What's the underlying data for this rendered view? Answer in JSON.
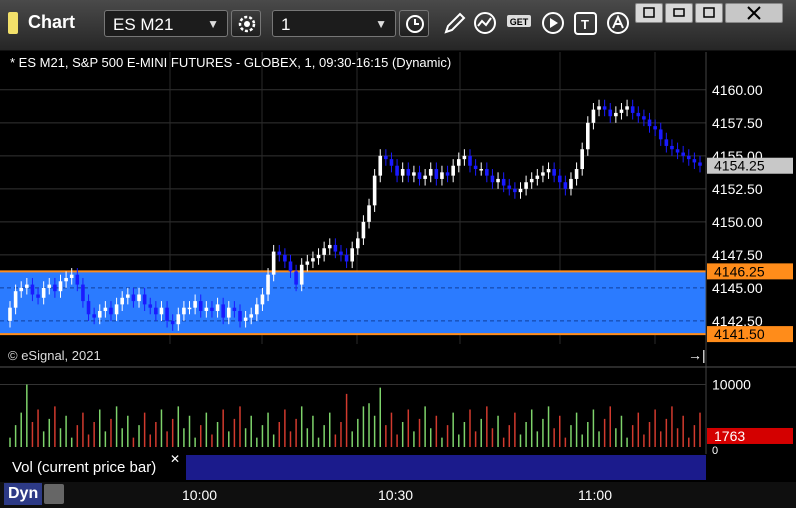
{
  "window": {
    "title": "Chart"
  },
  "toolbar": {
    "symbol": "ES M21",
    "interval": "1",
    "icons": [
      "gear-icon",
      "clock-icon",
      "pencil-icon",
      "study-icon",
      "get-icon",
      "play-icon",
      "text-icon",
      "alert-icon"
    ]
  },
  "chart_info": "* ES M21, S&P 500 E-MINI FUTURES - GLOBEX, 1, 09:30-16:15 (Dynamic)",
  "copyright": "© eSignal, 2021",
  "price_axis": {
    "ticks": [
      "4160.00",
      "4157.50",
      "4155.00",
      "4152.50",
      "4150.00",
      "4147.50",
      "4145.00",
      "4142.50"
    ],
    "last_price": "4154.25",
    "upper_level": "4146.25",
    "lower_level": "4141.50"
  },
  "volume": {
    "tick": "10000",
    "zero_tick": "0",
    "current": "1763",
    "label": "Vol (current price bar)"
  },
  "time_axis": [
    "10:00",
    "10:30",
    "11:00"
  ],
  "footer": {
    "mode": "Dyn"
  },
  "colors": {
    "band": "#2b7bff",
    "level": "#ff8c1a",
    "up": "#ffffff",
    "down": "#1a1aff",
    "vol_up": "#7ed36b",
    "vol_down": "#d23a2e",
    "last": "#c8c8c8"
  },
  "chart_data": {
    "type": "candlestick",
    "ylim": [
      4140.75,
      4161.5
    ],
    "candles_close": [
      4143.5,
      4144.75,
      4145,
      4145.25,
      4144.5,
      4144.25,
      4145,
      4145.25,
      4144.75,
      4145.5,
      4145.75,
      4146,
      4145.25,
      4144,
      4143,
      4142.75,
      4143.25,
      4143.5,
      4143,
      4143.75,
      4144.25,
      4144.5,
      4144,
      4144.5,
      4143.75,
      4143.5,
      4143,
      4143.5,
      4142.5,
      4142.25,
      4143,
      4143.5,
      4143.5,
      4144,
      4143.25,
      4143.5,
      4143.25,
      4143.75,
      4142.75,
      4143.5,
      4143.25,
      4142.5,
      4142.75,
      4143,
      4143.75,
      4144.5,
      4146,
      4147.75,
      4147.5,
      4147,
      4146.25,
      4145.25,
      4146.75,
      4147,
      4147.25,
      4147.5,
      4148,
      4148.25,
      4147.75,
      4147.5,
      4147,
      4148,
      4148.75,
      4150,
      4151.25,
      4153.5,
      4155,
      4154.75,
      4154.25,
      4153.5,
      4154,
      4153.5,
      4153.75,
      4153.25,
      4153.5,
      4154,
      4153.25,
      4153.75,
      4153.5,
      4154.25,
      4154.75,
      4155,
      4154.25,
      4154,
      4154,
      4153.5,
      4153,
      4153.25,
      4152.75,
      4152.5,
      4152.25,
      4152.5,
      4153,
      4153.25,
      4153.5,
      4153.75,
      4154,
      4153.5,
      4153,
      4152.5,
      4153.25,
      4154,
      4155.5,
      4157.5,
      4158.5,
      4158.75,
      4158.5,
      4158,
      4158.25,
      4158.5,
      4158.75,
      4158.25,
      4158,
      4157.75,
      4157.25,
      4157,
      4156.25,
      4155.75,
      4155.5,
      4155.25,
      4155,
      4154.75,
      4154.5,
      4154.25
    ],
    "volume_max": 12000
  }
}
